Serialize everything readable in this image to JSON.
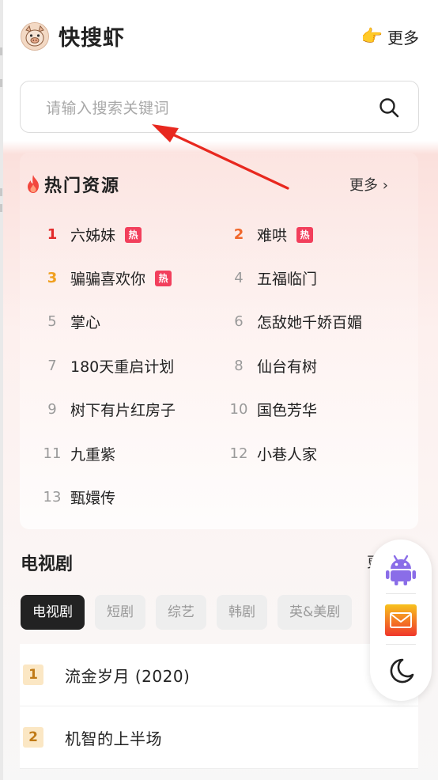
{
  "header": {
    "brand": "快搜虾",
    "more_label": "更多",
    "logo_icon": "pig-logo-icon",
    "more_icon": "pointing-hand-icon"
  },
  "search": {
    "placeholder": "请输入搜索关键词",
    "icon": "search-icon"
  },
  "hot": {
    "title": "热门资源",
    "more_label": "更多 ›",
    "items": [
      {
        "rank": "1",
        "name": "六姊妹",
        "badge": "热"
      },
      {
        "rank": "2",
        "name": "难哄",
        "badge": "热"
      },
      {
        "rank": "3",
        "name": "骗骗喜欢你",
        "badge": "热"
      },
      {
        "rank": "4",
        "name": "五福临门"
      },
      {
        "rank": "5",
        "name": "掌心"
      },
      {
        "rank": "6",
        "name": "怎敌她千娇百媚"
      },
      {
        "rank": "7",
        "name": "180天重启计划"
      },
      {
        "rank": "8",
        "name": "仙台有树"
      },
      {
        "rank": "9",
        "name": "树下有片红房子"
      },
      {
        "rank": "10",
        "name": "国色芳华"
      },
      {
        "rank": "11",
        "name": "九重紫"
      },
      {
        "rank": "12",
        "name": "小巷人家"
      },
      {
        "rank": "13",
        "name": "甄嬛传"
      }
    ]
  },
  "tv": {
    "title": "电视剧",
    "more_label": "更",
    "tabs": [
      "电视剧",
      "短剧",
      "综艺",
      "韩剧",
      "英&美剧"
    ],
    "active_tab": "电视剧",
    "list": [
      {
        "num": "1",
        "name": "流金岁月 (2020)"
      },
      {
        "num": "2",
        "name": "机智的上半场"
      }
    ]
  },
  "float_toolbar": {
    "icons": [
      "android-icon",
      "mail-icon",
      "moon-icon"
    ]
  },
  "colors": {
    "hot_badge": "#f23f5c",
    "rank1": "#e22b2b",
    "rank2": "#f0672b",
    "rank3": "#f0a020",
    "annotation_arrow": "#e8281f"
  }
}
